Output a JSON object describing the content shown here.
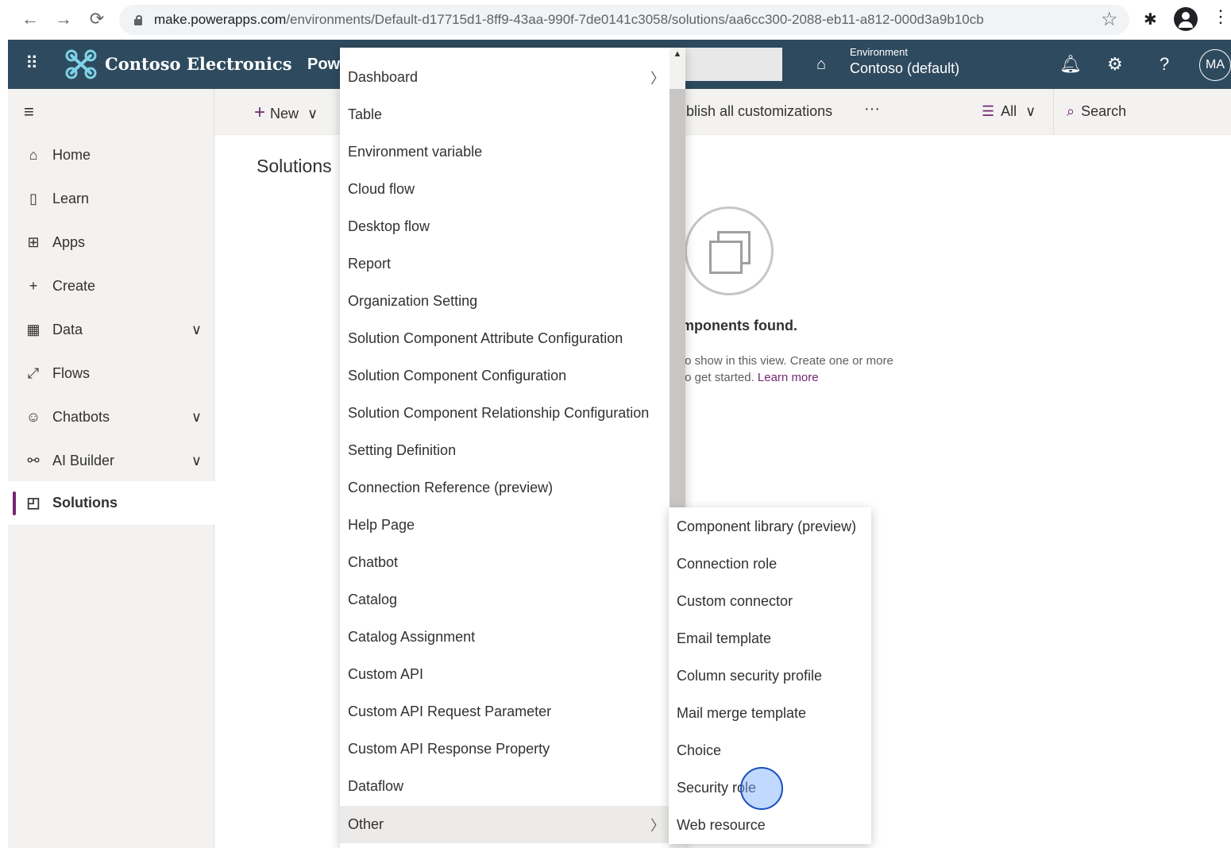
{
  "browser": {
    "url_domain": "make.powerapps.com",
    "url_path": "/environments/Default-d17715d1-8ff9-43aa-990f-7de0141c3058/solutions/aa6cc300-2088-eb11-a812-000d3a9b10cb"
  },
  "header": {
    "brand": "Contoso Electronics",
    "product": "Pow",
    "environment_label": "Environment",
    "environment_value": "Contoso (default)",
    "avatar": "MA"
  },
  "sidebar": {
    "items": [
      {
        "label": "Home",
        "icon": "home-icon"
      },
      {
        "label": "Learn",
        "icon": "book-icon"
      },
      {
        "label": "Apps",
        "icon": "apps-icon"
      },
      {
        "label": "Create",
        "icon": "plus-icon"
      },
      {
        "label": "Data",
        "icon": "table-icon"
      },
      {
        "label": "Flows",
        "icon": "flow-icon"
      },
      {
        "label": "Chatbots",
        "icon": "bot-icon"
      },
      {
        "label": "AI Builder",
        "icon": "ai-icon"
      },
      {
        "label": "Solutions",
        "icon": "solutions-icon"
      }
    ]
  },
  "commandbar": {
    "new": "New",
    "publish": "ublish all customizations",
    "filter": "All",
    "search": "Search"
  },
  "main": {
    "title": "Solutions",
    "empty_title": "mponents found.",
    "empty_desc1": "to show in this view. Create one or more",
    "empty_desc2_prefix": "to get started.",
    "learn_more": "Learn more"
  },
  "menu": {
    "items": [
      "Dashboard",
      "Table",
      "Environment variable",
      "Cloud flow",
      "Desktop flow",
      "Report",
      "Organization Setting",
      "Solution Component Attribute Configuration",
      "Solution Component Configuration",
      "Solution Component Relationship Configuration",
      "Setting Definition",
      "Connection Reference (preview)",
      "Help Page",
      "Chatbot",
      "Catalog",
      "Catalog Assignment",
      "Custom API",
      "Custom API Request Parameter",
      "Custom API Response Property",
      "Dataflow",
      "Other"
    ]
  },
  "submenu": {
    "items": [
      "Component library (preview)",
      "Connection role",
      "Custom connector",
      "Email template",
      "Column security profile",
      "Mail merge template",
      "Choice",
      "Security role",
      "Web resource"
    ]
  },
  "colors": {
    "header": "#2e4a5e",
    "accent": "#742774"
  }
}
